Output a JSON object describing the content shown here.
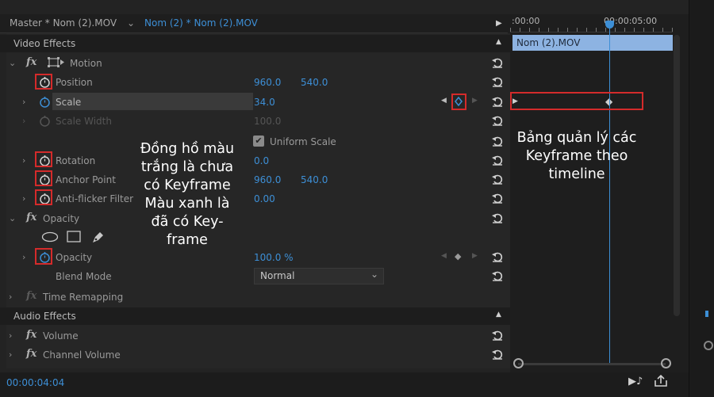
{
  "tabs": {
    "master": "Master * Nom (2).MOV",
    "active": "Nom (2) * Nom (2).MOV"
  },
  "sections": {
    "video_effects": "Video Effects",
    "audio_effects": "Audio Effects"
  },
  "motion": {
    "label": "Motion",
    "position": {
      "label": "Position",
      "x": "960.0",
      "y": "540.0"
    },
    "scale": {
      "label": "Scale",
      "value": "34.0"
    },
    "scale_width": {
      "label": "Scale Width",
      "value": "100.0"
    },
    "uniform_scale": {
      "label": "Uniform Scale",
      "checked": true
    },
    "rotation": {
      "label": "Rotation",
      "value": "0.0"
    },
    "anchor_point": {
      "label": "Anchor Point",
      "x": "960.0",
      "y": "540.0"
    },
    "anti_flicker": {
      "label": "Anti-flicker Filter",
      "value": "0.00"
    }
  },
  "opacity": {
    "label": "Opacity",
    "opacity": {
      "label": "Opacity",
      "value": "100.0 %"
    },
    "blend_mode": {
      "label": "Blend Mode",
      "value": "Normal"
    }
  },
  "time_remapping": "Time Remapping",
  "audio": {
    "volume": "Volume",
    "channel_volume": "Channel Volume"
  },
  "timeline": {
    "time_start": ":00:00",
    "time_mark": "00:00:05:00",
    "clip_name": "Nom (2).MOV",
    "playhead_fraction": 0.62
  },
  "timecode": "00:00:04:04",
  "annotations": {
    "stopwatch_note": [
      "Đồng hồ màu",
      "trắng là chưa",
      "có Keyframe",
      "Màu xanh là",
      "đã có Key-",
      "frame"
    ],
    "keyframe_note": [
      "Bảng quản lý các",
      "Keyframe theo",
      "timeline"
    ]
  },
  "colors": {
    "accent_blue": "#3d8fd6",
    "clip_blue": "#8db3e2",
    "highlight_red": "#d42b2b"
  },
  "icons": [
    "chevron-down-icon",
    "fx-icon",
    "motion-transform-icon",
    "stopwatch-icon",
    "reset-icon",
    "keyframe-nav-icon",
    "ellipse-mask-icon",
    "rect-mask-icon",
    "pen-mask-icon",
    "play-audio-icon",
    "export-icon"
  ]
}
